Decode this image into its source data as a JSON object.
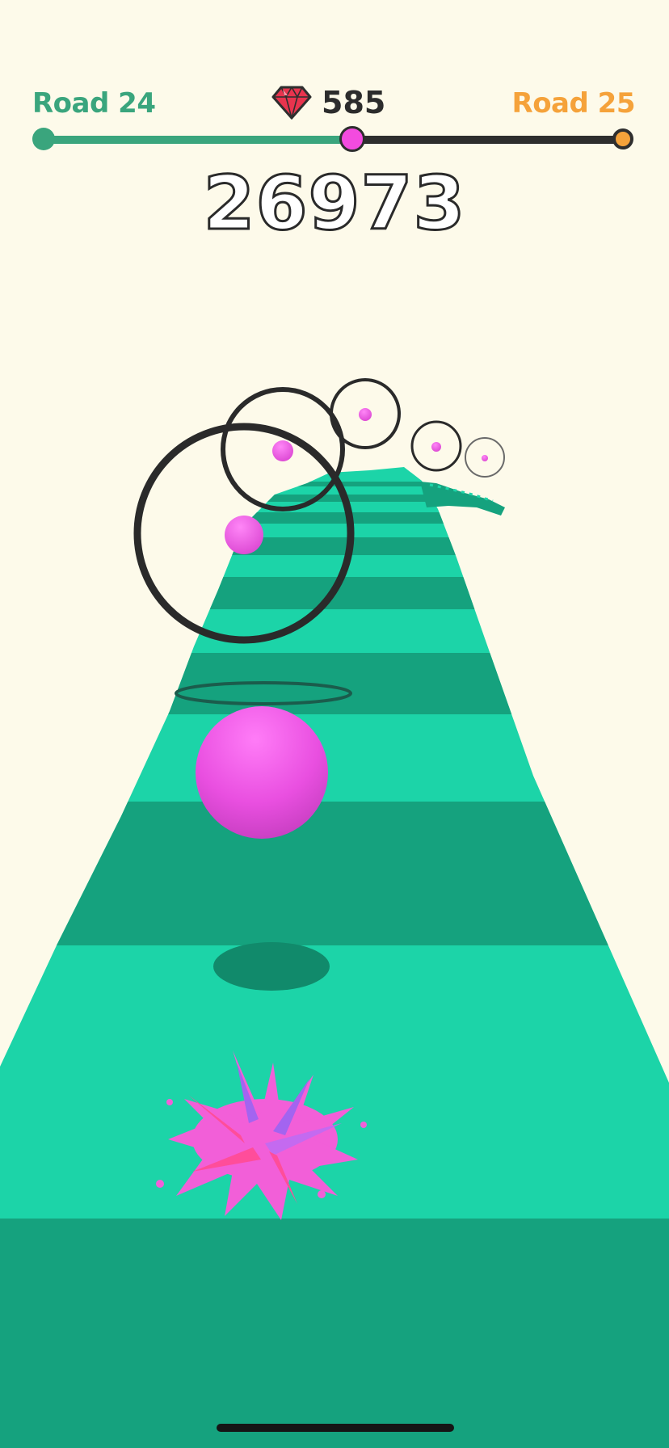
{
  "hud": {
    "road_current": "Road 24",
    "road_next": "Road 25",
    "gem_count": "585",
    "score": "26973",
    "progress": 0.53
  },
  "icons": {
    "gem": "red-diamond"
  },
  "colors": {
    "background": "#fdfaea",
    "road_light": "#1cd4a8",
    "road_dark": "#15a27e",
    "ball": "#e84fe0",
    "ring": "#2a2a2a",
    "road_label_current": "#3aa57d",
    "road_label_next": "#f5a23a"
  }
}
